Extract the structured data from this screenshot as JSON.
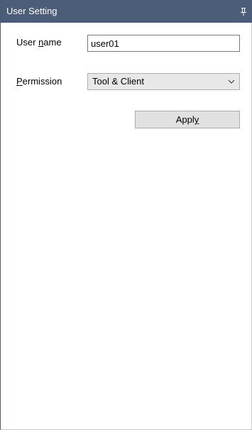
{
  "panel": {
    "title": "User Setting",
    "pin_icon": "pin-icon"
  },
  "form": {
    "username": {
      "label_pre": "User ",
      "label_access": "n",
      "label_post": "ame",
      "value": "user01"
    },
    "permission": {
      "label_pre": "",
      "label_access": "P",
      "label_post": "ermission",
      "selected": "Tool & Client",
      "chevron_icon": "chevron-down-icon"
    },
    "apply": {
      "label_pre": "Appl",
      "label_access": "y",
      "label_post": ""
    }
  },
  "colors": {
    "titlebar_bg": "#4c5d7a",
    "titlebar_text": "#ffffff",
    "button_bg": "#e1e1e1",
    "combo_bg": "#e8e8e8"
  }
}
